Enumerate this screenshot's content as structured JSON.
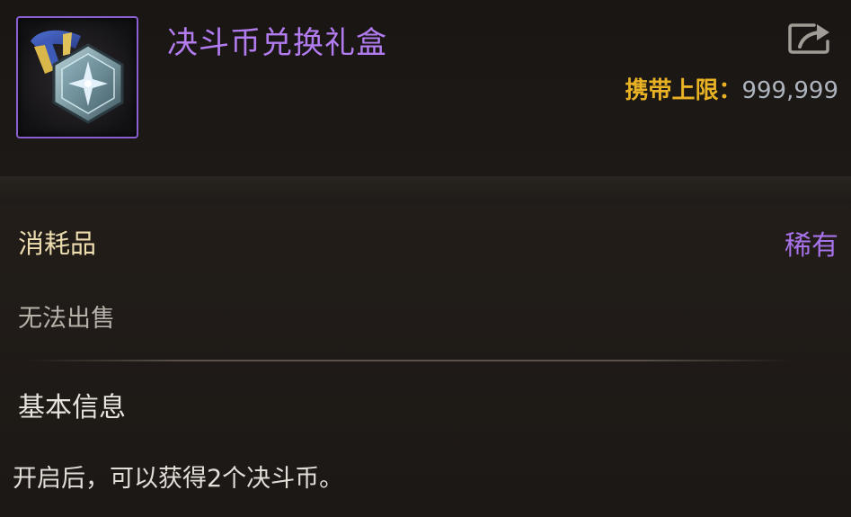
{
  "item": {
    "name": "决斗币兑换礼盒",
    "icon": "hexagon-medal-icon",
    "carry_limit_label": "携带上限",
    "carry_limit_colon": "：",
    "carry_limit_value": "999,999",
    "type": "消耗品",
    "rarity": "稀有",
    "sell_status": "无法出售",
    "section_title": "基本信息",
    "description": "开启后，可以获得2个决斗币。"
  },
  "colors": {
    "title_purple": "#b27cf0",
    "rarity_purple": "#a772ea",
    "carry_label_gold": "#e8b224",
    "frame_purple": "#8a5fd0"
  },
  "actions": {
    "share_icon": "share-export-icon"
  }
}
